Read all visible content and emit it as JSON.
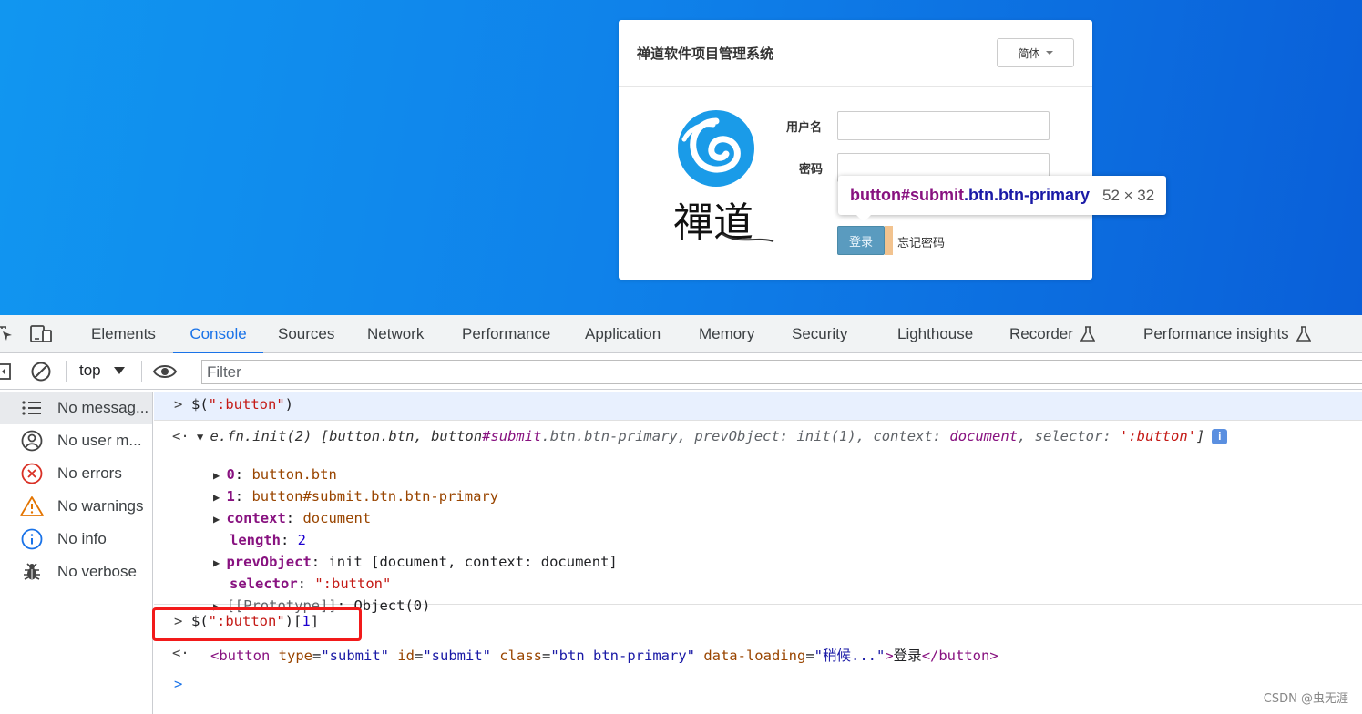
{
  "page": {
    "title": "禅道软件项目管理系统",
    "lang_button": "简体",
    "logo_text": "禪道",
    "username_label": "用户名",
    "password_label": "密码",
    "login_button": "登录",
    "forgot_link": "忘记密码"
  },
  "tooltip": {
    "tag": "button",
    "id": "#submit",
    "classes": ".btn.btn-primary",
    "size": "52 × 32"
  },
  "devtools": {
    "tabs": [
      "Elements",
      "Console",
      "Sources",
      "Network",
      "Performance",
      "Application",
      "Memory",
      "Security",
      "Lighthouse",
      "Recorder",
      "Performance insights"
    ],
    "active_tab": "Console",
    "context": "top",
    "filter_placeholder": "Filter",
    "sidebar": [
      {
        "label": "No messag...",
        "icon": "list-icon"
      },
      {
        "label": "No user m...",
        "icon": "user-icon"
      },
      {
        "label": "No errors",
        "icon": "error-icon"
      },
      {
        "label": "No warnings",
        "icon": "warning-icon"
      },
      {
        "label": "No info",
        "icon": "info-icon"
      },
      {
        "label": "No verbose",
        "icon": "bug-icon"
      }
    ]
  },
  "console": {
    "cmd1_a": "$(",
    "cmd1_str": "\":button\"",
    "cmd1_b": ")",
    "res1_name": "e.fn.init(2)",
    "res1_open": " [",
    "res1_body1": "button.btn, button",
    "res1_id": "#submit",
    "res1_body2": ".btn.btn-primary, prevObject: init(1), context: ",
    "res1_doc": "document",
    "res1_body3": ", selector: ",
    "res1_sel": "':button'",
    "res1_close": "]",
    "p0_key": "0",
    "p0_val": "button.btn",
    "p1_key": "1",
    "p1_val": "button#submit.btn.btn-primary",
    "p_context_key": "context",
    "p_context_val": "document",
    "p_length_key": "length",
    "p_length_val": "2",
    "p_prev_key": "prevObject",
    "p_prev_val": "init [document, context: document]",
    "p_sel_key": "selector",
    "p_sel_val": "\":button\"",
    "p_proto_key": "[[Prototype]]",
    "p_proto_val": "Object(0)",
    "cmd2_a": "$(",
    "cmd2_str": "\":button\"",
    "cmd2_b": ")[",
    "cmd2_num": "1",
    "cmd2_c": "]",
    "html_open": "<button",
    "html_attr1": " type",
    "html_val1": "\"submit\"",
    "html_attr2": " id",
    "html_val2": "\"submit\"",
    "html_attr3": " class",
    "html_val3": "\"btn btn-primary\"",
    "html_attr4": " data-loading",
    "html_val4": "\"稍候...\"",
    "html_gt": ">",
    "html_text": "登录",
    "html_close": "</button>"
  },
  "watermark": "CSDN @虫无涯",
  "colors": {
    "accent": "#1a73e8",
    "highlight_box": "#f21a1a",
    "page_bg": "#1196f0"
  }
}
